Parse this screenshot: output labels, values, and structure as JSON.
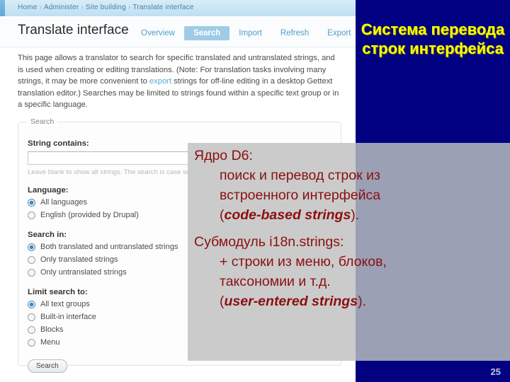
{
  "breadcrumb": {
    "items": [
      "Home",
      "Administer",
      "Site building",
      "Translate interface"
    ],
    "separator": "›"
  },
  "page": {
    "title": "Translate interface",
    "tabs": [
      {
        "label": "Overview",
        "active": false
      },
      {
        "label": "Search",
        "active": true
      },
      {
        "label": "Import",
        "active": false
      },
      {
        "label": "Refresh",
        "active": false
      },
      {
        "label": "Export",
        "active": false
      }
    ],
    "intro_part1": "This page allows a translator to search for specific translated and untranslated strings, and is used when creating or editing translations. (Note: For translation tasks involving many strings, it may be more convenient to ",
    "intro_link": "export",
    "intro_part2": " strings for off-line editing in a desktop Gettext translation editor.) Searches may be limited to strings found within a specific text group or in a specific language."
  },
  "search_form": {
    "legend": "Search",
    "string_contains_label": "String contains:",
    "string_contains_value": "",
    "string_contains_placeholder": "",
    "string_contains_hint": "Leave blank to show all strings. The search is case sensitive.",
    "language_label": "Language:",
    "language_options": [
      {
        "label": "All languages",
        "checked": true
      },
      {
        "label": "English (provided by Drupal)",
        "checked": false
      }
    ],
    "search_in_label": "Search in:",
    "search_in_options": [
      {
        "label": "Both translated and untranslated strings",
        "checked": true
      },
      {
        "label": "Only translated strings",
        "checked": false
      },
      {
        "label": "Only untranslated strings",
        "checked": false
      }
    ],
    "limit_search_label": "Limit search to:",
    "limit_search_options": [
      {
        "label": "All text groups",
        "checked": true
      },
      {
        "label": "Built-in interface",
        "checked": false
      },
      {
        "label": "Blocks",
        "checked": false
      },
      {
        "label": "Menu",
        "checked": false
      }
    ],
    "submit_label": "Search"
  },
  "slide": {
    "title": "Система перевода строк интерфейса",
    "title_color": "#ffff00",
    "navy_color": "#000080",
    "body_color": "#8b1010",
    "blocks": [
      {
        "head": "Ядро D6:",
        "lines": [
          "поиск и перевод строк из",
          "встроенного интерфейса"
        ],
        "emphasis_prefix": "(",
        "emphasis": "code-based strings",
        "emphasis_suffix": ")."
      },
      {
        "head": "Субмодуль i18n.strings:",
        "lines": [
          "+ строки из меню, блоков,",
          "таксономии и т.д."
        ],
        "emphasis_prefix": "(",
        "emphasis": "user-entered strings",
        "emphasis_suffix": ")."
      }
    ],
    "page_number": "25"
  }
}
